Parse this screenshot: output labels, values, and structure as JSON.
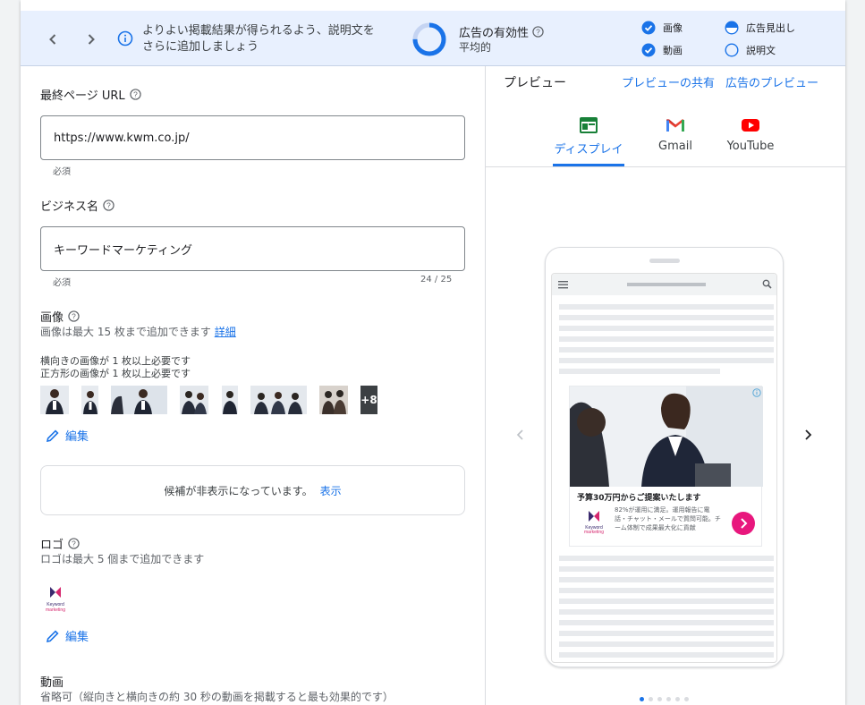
{
  "banner": {
    "message": "よりよい掲載結果が得られるよう、説明文をさらに追加しましょう",
    "effectiveness_title": "広告の有効性",
    "effectiveness_value": "平均的",
    "progress_fraction": 0.75,
    "checks": [
      {
        "label": "画像",
        "state": "checked"
      },
      {
        "label": "動画",
        "state": "checked"
      },
      {
        "label": "広告見出し",
        "state": "partial"
      },
      {
        "label": "説明文",
        "state": "empty"
      }
    ]
  },
  "form": {
    "final_url_label": "最終ページ URL",
    "final_url_value": "https://www.kwm.co.jp/",
    "final_url_hint": "必須",
    "business_label": "ビジネス名",
    "business_value": "キーワードマーケティング",
    "business_hint": "必須",
    "business_count": "24 / 25",
    "images_label": "画像",
    "images_sub": "画像は最大 15 枚まで追加できます",
    "images_link": "詳細",
    "images_req1": "横向きの画像が 1 枚以上必要です",
    "images_req2": "正方形の画像が 1 枚以上必要です",
    "images_more": "+8",
    "edit_label": "編集",
    "hidden_text": "候補が非表示になっています。",
    "hidden_link": "表示",
    "logo_label": "ロゴ",
    "logo_sub": "ロゴは最大 5 個まで追加できます",
    "logo_brand": "Keyword marketing",
    "logo_edit_label": "編集",
    "video_label": "動画",
    "video_sub": "省略可（縦向きと横向きの約 30 秒の動画を掲載すると最も効果的です）"
  },
  "preview": {
    "title": "プレビュー",
    "share_link": "プレビューの共有",
    "ad_preview_link": "広告のプレビュー",
    "tabs": [
      {
        "label": "ディスプレイ",
        "icon": "display-icon",
        "active": true
      },
      {
        "label": "Gmail",
        "icon": "gmail-icon",
        "active": false
      },
      {
        "label": "YouTube",
        "icon": "youtube-icon",
        "active": false
      }
    ],
    "ad": {
      "headline": "予算30万円からご提案いたします",
      "body": "82%が運用に満足。運用報告に電話・チャット・メールで質問可能。チーム体制で成果最大化に貢献",
      "logo_text": "Keyword marketing"
    },
    "page_dots": 6,
    "active_dot": 0
  },
  "colors": {
    "accent": "#1a73e8",
    "banner_bg": "#e8f0fe",
    "ad_button": "#e8177d"
  }
}
